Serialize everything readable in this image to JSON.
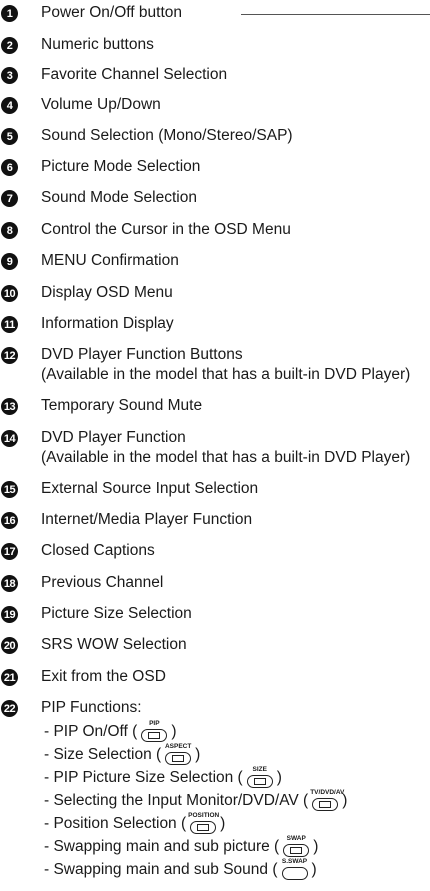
{
  "items": [
    {
      "num": "1",
      "label": "Power On/Off button"
    },
    {
      "num": "2",
      "label": "Numeric buttons"
    },
    {
      "num": "3",
      "label": "Favorite Channel Selection"
    },
    {
      "num": "4",
      "label": "Volume Up/Down"
    },
    {
      "num": "5",
      "label": "Sound Selection (Mono/Stereo/SAP)"
    },
    {
      "num": "6",
      "label": "Picture Mode Selection"
    },
    {
      "num": "7",
      "label": "Sound Mode Selection"
    },
    {
      "num": "8",
      "label": "Control the Cursor in the OSD Menu"
    },
    {
      "num": "9",
      "label": "MENU Confirmation"
    },
    {
      "num": "10",
      "label": "Display OSD Menu"
    },
    {
      "num": "11",
      "label": "Information Display"
    },
    {
      "num": "12",
      "label": "DVD Player Function Buttons",
      "sub": "(Available in the model that has a built-in DVD Player)"
    },
    {
      "num": "13",
      "label": "Temporary Sound Mute"
    },
    {
      "num": "14",
      "label": "DVD Player Function",
      "sub": "(Available in the model that has a built-in DVD Player)"
    },
    {
      "num": "15",
      "label": "External Source Input Selection"
    },
    {
      "num": "16",
      "label": "Internet/Media Player Function"
    },
    {
      "num": "17",
      "label": "Closed Captions"
    },
    {
      "num": "18",
      "label": "Previous Channel"
    },
    {
      "num": "19",
      "label": "Picture Size Selection"
    },
    {
      "num": "20",
      "label": "SRS WOW Selection"
    },
    {
      "num": "21",
      "label": "Exit from the OSD"
    },
    {
      "num": "22",
      "label": "PIP Functions:"
    }
  ],
  "pip_functions": [
    {
      "text": "- PIP On/Off (",
      "icon_label": "PIP"
    },
    {
      "text": "- Size Selection (",
      "icon_label": "ASPECT"
    },
    {
      "text": "- PIP Picture Size Selection (",
      "icon_label": "SIZE"
    },
    {
      "text": "- Selecting the Input Monitor/DVD/AV (",
      "icon_label": "TV/DVD/AV"
    },
    {
      "text": "- Position Selection (",
      "icon_label": "POSITION"
    },
    {
      "text": "- Swapping main and sub picture (",
      "icon_label": "SWAP"
    },
    {
      "text": "- Swapping main and sub Sound (",
      "icon_label": "S.SWAP"
    }
  ],
  "close_paren": ")"
}
